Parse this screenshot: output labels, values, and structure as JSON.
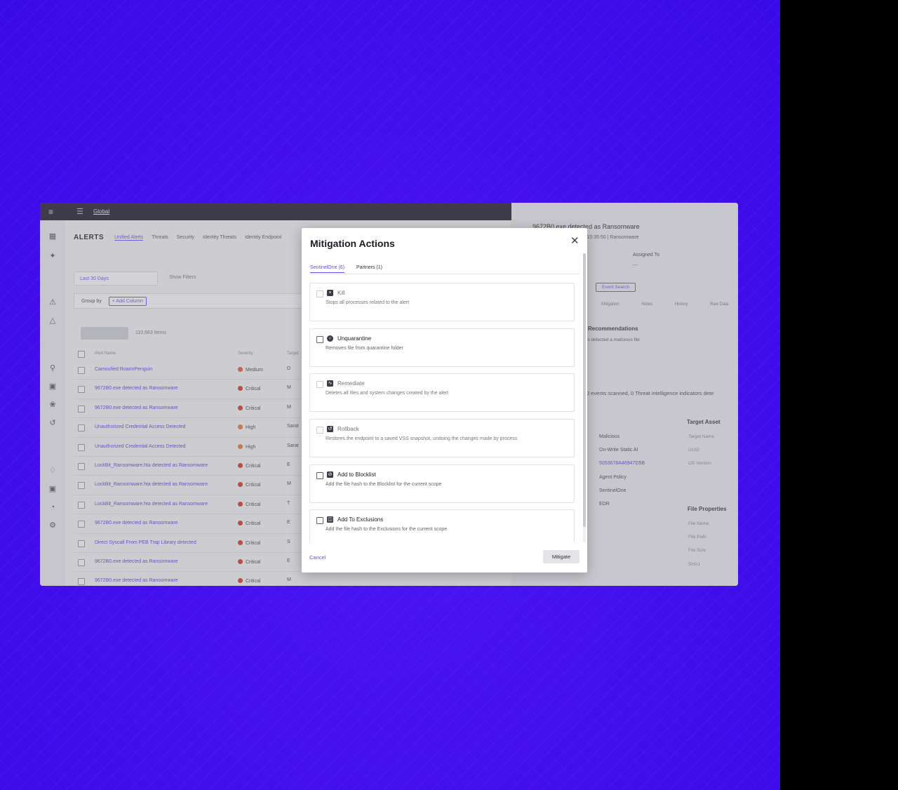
{
  "topbar": {
    "scope": "Global"
  },
  "header": {
    "title": "ALERTS",
    "tabs": [
      "Unified Alerts",
      "Threats",
      "Security",
      "Identity Threats",
      "Identity Endpoint"
    ]
  },
  "toolbar": {
    "date_filter": "Last 30 Days",
    "show_filters": "Show Filters",
    "group_by": "Group by",
    "add_column": "+ Add Column",
    "items_count": "110,663 Items"
  },
  "table": {
    "columns": [
      "Alert Name",
      "Severity",
      "Target"
    ],
    "rows": [
      {
        "name": "Camoufied RoarinPenguin",
        "severity": "Medium",
        "target": "D"
      },
      {
        "name": "9672B0.exe detected as Ransomware",
        "severity": "Critical",
        "target": "M"
      },
      {
        "name": "9672B0.exe detected as Ransomware",
        "severity": "Critical",
        "target": "M"
      },
      {
        "name": "Unauthorized Credential Access Detected",
        "severity": "High",
        "target": "Sarat"
      },
      {
        "name": "Unauthorized Credential Access Detected",
        "severity": "High",
        "target": "Sarat"
      },
      {
        "name": "LockBit_Ransomware.hta detected as Ransomware",
        "severity": "Critical",
        "target": "E"
      },
      {
        "name": "LockBit_Ransomware.hta detected as Ransomware",
        "severity": "Critical",
        "target": "M"
      },
      {
        "name": "LockBit_Ransomware.hta detected as Ransomware",
        "severity": "Critical",
        "target": "T"
      },
      {
        "name": "9672B0.exe detected as Ransomware",
        "severity": "Critical",
        "target": "E"
      },
      {
        "name": "Direct Syscall From PEB Trap Library detected",
        "severity": "Critical",
        "target": "S"
      },
      {
        "name": "9672B0.exe detected as Ransomware",
        "severity": "Critical",
        "target": "E"
      },
      {
        "name": "9672B0.exe detected as Ransomware",
        "severity": "Critical",
        "target": "M"
      }
    ]
  },
  "detail": {
    "title": "9672B0.exe detected as Ransomware",
    "subtitle": ", 2024, 15:35:50 | Ransomware",
    "assigned_to": "Assigned To",
    "assigned_value": "---",
    "event_search": "Event Search",
    "tabs": [
      "Mitigation",
      "Notes",
      "History",
      "Raw Data"
    ],
    "recommendations": "Recommendations",
    "reco_text": "is detected a malicious file",
    "scan_text": "0 events scanned, 0 Threat intelligence indicators dete",
    "fields": [
      "Malicious",
      "On-Write Static AI",
      "5053678A46947D5B",
      "Agent Policy",
      "SentinelOne",
      "EDR"
    ],
    "target_asset": "Target Asset",
    "target_fields": [
      "Target Name",
      "UUID",
      "OS Version"
    ],
    "file_properties": "File Properties",
    "file_fields": [
      "File Name",
      "File Path",
      "File Size",
      "SHA1"
    ]
  },
  "modal": {
    "title": "Mitigation Actions",
    "tabs": [
      "SentinelOne (6)",
      "Partners (1)"
    ],
    "actions": [
      {
        "label": "Kill",
        "desc": "Stops all processes related to the alert"
      },
      {
        "label": "Unquarantine",
        "desc": "Removes file from quarantine folder"
      },
      {
        "label": "Remediate",
        "desc": "Deletes all files and system changes created by the alert"
      },
      {
        "label": "Rollback",
        "desc": "Restores the endpoint to a saved VSS snapshot, undoing the changes made by process"
      },
      {
        "label": "Add to Blocklist",
        "desc": "Add the file hash to the Blocklist for the current scope"
      },
      {
        "label": "Add To Exclusions",
        "desc": "Add the file hash to the Exclusions for the current scope"
      }
    ],
    "cancel": "Cancel",
    "mitigate": "Mitigate"
  },
  "colors": {
    "accent": "#6b4df0",
    "critical": "#d9341e",
    "high": "#e8762d",
    "medium": "#e35a2b",
    "background": "#4410ee"
  }
}
